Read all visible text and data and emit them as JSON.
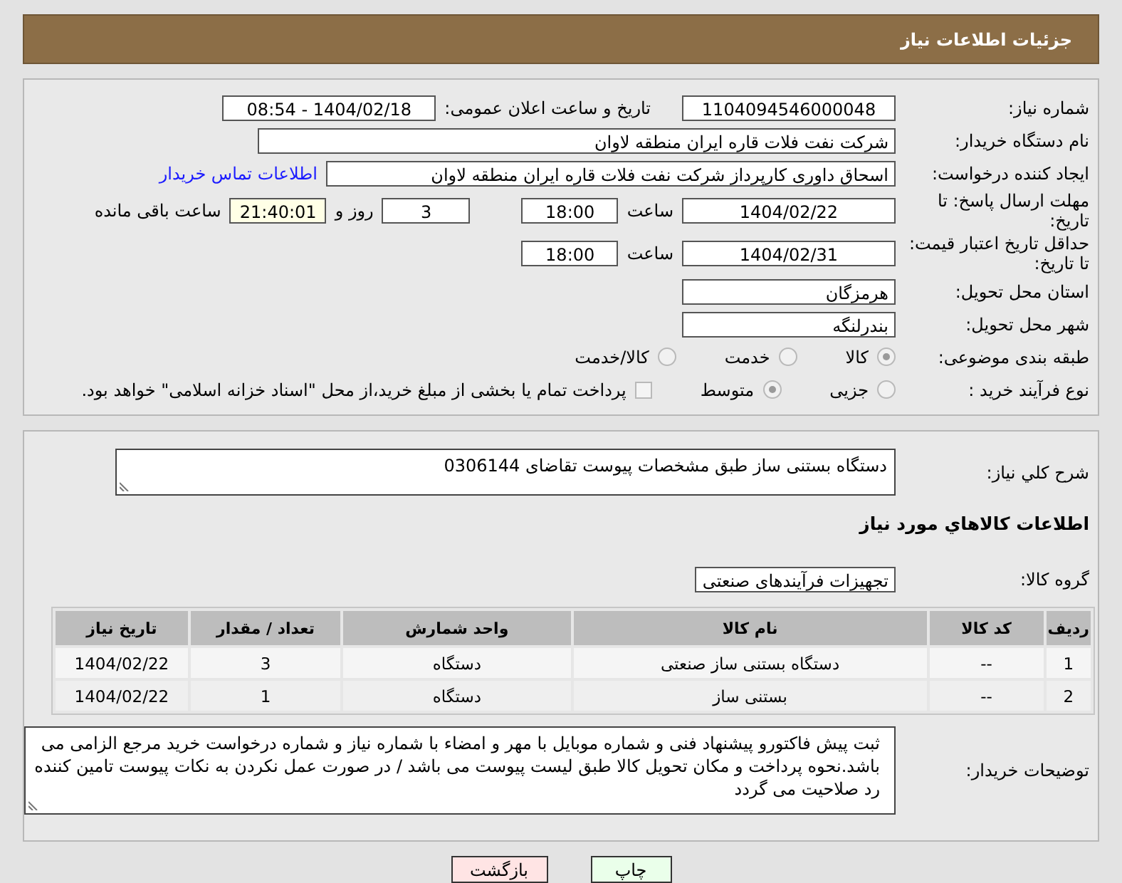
{
  "header": {
    "title": "جزئیات اطلاعات نیاز"
  },
  "need_number": {
    "label": "شماره نیاز:",
    "value": "1104094546000048"
  },
  "announce": {
    "label": "تاریخ و ساعت اعلان عمومی:",
    "value": "1404/02/18 - 08:54"
  },
  "buyer_org": {
    "label": "نام دستگاه خریدار:",
    "value": "شرکت نفت فلات قاره ایران منطقه لاوان"
  },
  "requester": {
    "label": "ایجاد کننده درخواست:",
    "value": "اسحاق داوری کارپرداز شرکت نفت فلات قاره ایران منطقه لاوان",
    "link": "اطلاعات تماس خریدار"
  },
  "deadline": {
    "label": "مهلت ارسال پاسخ: تا تاریخ:",
    "date": "1404/02/22",
    "time_label": "ساعت",
    "time": "18:00",
    "days": "3",
    "days_label": "روز و",
    "remaining": "21:40:01",
    "remaining_label": "ساعت باقی مانده"
  },
  "validity": {
    "label": "حداقل تاریخ اعتبار قیمت: تا تاریخ:",
    "date": "1404/02/31",
    "time_label": "ساعت",
    "time": "18:00"
  },
  "province": {
    "label": "استان محل تحویل:",
    "value": "هرمزگان"
  },
  "city": {
    "label": "شهر محل تحویل:",
    "value": "بندرلنگه"
  },
  "category": {
    "label": "طبقه بندی موضوعی:",
    "options": [
      {
        "label": "کالا",
        "selected": true
      },
      {
        "label": "خدمت",
        "selected": false
      },
      {
        "label": "کالا/خدمت",
        "selected": false
      }
    ]
  },
  "process": {
    "label": "نوع فرآیند خرید :",
    "options": [
      {
        "label": "جزیی",
        "selected": false
      },
      {
        "label": "متوسط",
        "selected": true
      }
    ],
    "treasury": {
      "label": "پرداخت تمام یا بخشی از مبلغ خرید،از محل \"اسناد خزانه اسلامی\" خواهد بود.",
      "checked": false
    }
  },
  "description": {
    "label": "شرح کلي نياز:",
    "value": "دستگاه بستنی ساز طبق مشخصات پیوست تقاضای 0306144"
  },
  "items_title": "اطلاعات کالاهاي مورد نياز",
  "goods_group": {
    "label": "گروه کالا:",
    "value": "تجهیزات فرآیندهای صنعتی"
  },
  "table": {
    "columns": [
      "ردیف",
      "کد کالا",
      "نام کالا",
      "واحد شمارش",
      "تعداد / مقدار",
      "تاریخ نیاز"
    ],
    "rows": [
      [
        "1",
        "--",
        "دستگاه بستنی ساز صنعتی",
        "دستگاه",
        "3",
        "1404/02/22"
      ],
      [
        "2",
        "--",
        "بستنی ساز",
        "دستگاه",
        "1",
        "1404/02/22"
      ]
    ]
  },
  "buyer_notes": {
    "label": "توضیحات خریدار:",
    "value": "ثبت پیش فاکتورو پیشنهاد فنی و شماره موبایل با مهر و امضاء با شماره نیاز و شماره درخواست خرید مرجع الزامی می باشد.نحوه پرداخت و مکان تحویل کالا طبق لیست پیوست می باشد / در صورت عمل نکردن به نکات پیوست تامین کننده رد صلاحیت می گردد"
  },
  "buttons": [
    {
      "label": "چاپ",
      "kind": "print"
    },
    {
      "label": "بازگشت",
      "kind": "back"
    }
  ]
}
